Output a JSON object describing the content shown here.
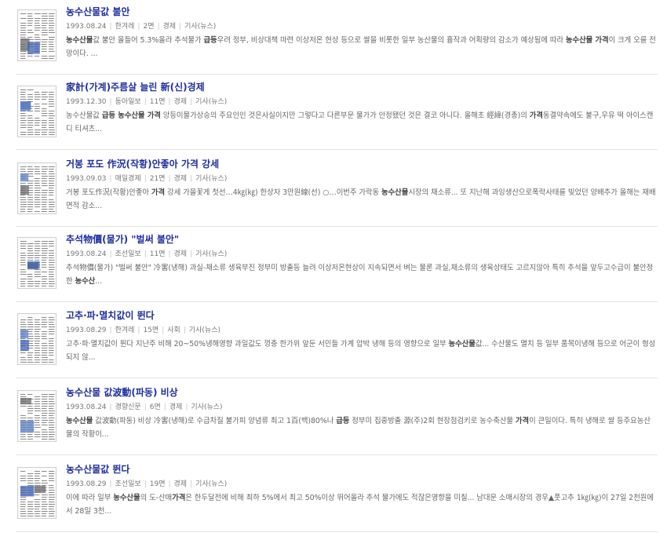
{
  "results": [
    {
      "title": "농수산물값 불안",
      "date": "1993.08.24",
      "paper": "한겨레",
      "page": "2면",
      "section": "경제",
      "type": "기사(뉴스)",
      "snippet": [
        {
          "t": "농수산물",
          "b": true
        },
        {
          "t": "값 불안 올들어 5.3%올라 추석물가 ",
          "b": false
        },
        {
          "t": "급등",
          "b": true
        },
        {
          "t": "우려 정부, 비상대책 마련 이상저온 현상 등으로 쌀을 비롯한 일부 농산물의 흉작과 어획량의 감소가 예상됨에 따라 ",
          "b": false
        },
        {
          "t": "농수산물 가격",
          "b": true
        },
        {
          "t": "이 크게 오를 전망이다. ...",
          "b": false
        }
      ]
    },
    {
      "title": "家計(가계)주름살 늘린 新(신)경제",
      "date": "1993.12.30",
      "paper": "동아일보",
      "page": "11면",
      "section": "경제",
      "type": "기사(뉴스)",
      "snippet": [
        {
          "t": "농수산물값 ",
          "b": false
        },
        {
          "t": "급등 농수산물 가격",
          "b": true
        },
        {
          "t": " 앙등이물가상승의 주요인인 것은사실이지만 그렇다고 다른부문 물가가 안정됐던 것은 결코 아니다. 올해초 經緯(경총)의 ",
          "b": false
        },
        {
          "t": "가격",
          "b": true
        },
        {
          "t": "동결약속에도 불구,우유 떡 아이스캔디 티셔츠...",
          "b": false
        }
      ]
    },
    {
      "title": "거봉 포도 作況(작황)안좋아 가격 강세",
      "date": "1993.09.03",
      "paper": "매일경제",
      "page": "21면",
      "section": "경제",
      "type": "기사(뉴스)",
      "snippet": [
        {
          "t": "거봉 포도作況(작황)안좋아 ",
          "b": false
        },
        {
          "t": "가격",
          "b": true
        },
        {
          "t": " 강세 가을꽃게 첫선…4㎏(㎏) 한상자 3만원線(선) ○…이번주 가락동 ",
          "b": false
        },
        {
          "t": "농수산물",
          "b": true
        },
        {
          "t": "시장의 채소류... 또 지난해 과잉생산으로폭락사태를 빚었던 양배추가 올해는 재배면적 감소...",
          "b": false
        }
      ]
    },
    {
      "title": "추석物價(물가) \"벌써 불안\"",
      "date": "1993.08.24",
      "paper": "조선일보",
      "page": "11면",
      "section": "경제",
      "type": "기사(뉴스)",
      "snippet": [
        {
          "t": "추석物價(물가) \"벌써 불안\" 冷害(냉해) 과실-채소류 생육부진 정부미 방출등 늘려 이상저온현상이 지속되면서 벼는 물론 과실,채소류의 생육상태도 고르지않아 특히 추석을 앞두고수급이 불안정한 ",
          "b": false
        },
        {
          "t": "농수산",
          "b": true
        },
        {
          "t": "...",
          "b": false
        }
      ]
    },
    {
      "title": "고추·파·멸치값이 뛴다",
      "date": "1993.08.29",
      "paper": "한겨레",
      "page": "15면",
      "section": "사회",
      "type": "기사(뉴스)",
      "snippet": [
        {
          "t": "고추·파·멸치값이 뛴다 지난주 비해 20~50%냉해영향 과일값도 껑충 한가위 앞둔 서민들 가계 압박 냉해 등의 영향으로 일부 ",
          "b": false
        },
        {
          "t": "농수산물",
          "b": true
        },
        {
          "t": "값... 수산물도 멸치 등 일부 품목이냉해 등으로 어군이 형성되지 않...",
          "b": false
        }
      ]
    },
    {
      "title": "농수산물 값波動(파동) 비상",
      "date": "1993.08.24",
      "paper": "경향신문",
      "page": "6면",
      "section": "경제",
      "type": "기사(뉴스)",
      "snippet": [
        {
          "t": "농수산물",
          "b": true
        },
        {
          "t": " 값波動(파동) 비상 冷害(냉해)로 수급차질 불가피 양념류 최고 1百(백)80%나 ",
          "b": false
        },
        {
          "t": "급등",
          "b": true
        },
        {
          "t": " 정부미 집중방출 源(주)2회 현장점검키로 농수축산물 ",
          "b": false
        },
        {
          "t": "가격",
          "b": true
        },
        {
          "t": "이 큰일이다. 특히 냉해로 쌀 등주요농산물의 작황이...",
          "b": false
        }
      ]
    },
    {
      "title": "농수산물값 뛴다",
      "date": "1993.08.29",
      "paper": "조선일보",
      "page": "19면",
      "section": "경제",
      "type": "기사(뉴스)",
      "snippet": [
        {
          "t": "이에 따라 일부 ",
          "b": false
        },
        {
          "t": "농수산물",
          "b": true
        },
        {
          "t": "의 도-산매",
          "b": false
        },
        {
          "t": "가격",
          "b": true
        },
        {
          "t": "은 한두달전에 비해 최하 5%에서 최고 50%이상 뛰어올라 추석 물가에도 적잖은영향을 미칠... 남대문 소매시장의 경우▲풋고추 1㎏(㎏)이 27일 2천원에서 28일 3천...",
          "b": false
        }
      ]
    }
  ]
}
